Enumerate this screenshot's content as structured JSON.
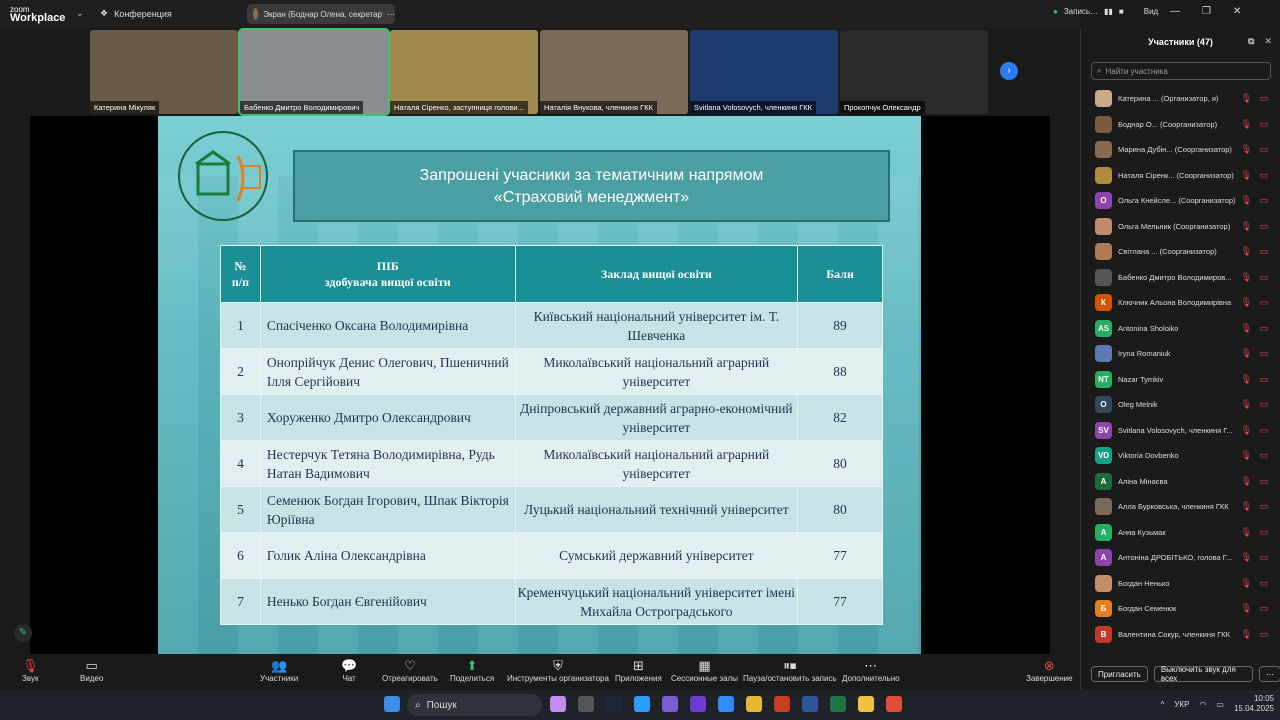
{
  "app": {
    "logo_top": "zoom",
    "logo_bottom": "Workplace",
    "meeting_label": "Конференция",
    "screen_share": "Экран (Боднар Олена, секретар",
    "recording": "Запись…",
    "view": "Вид"
  },
  "thumbnails": [
    {
      "name": "Катерина Мікуляк",
      "bg": "#6a5a48"
    },
    {
      "name": "Бабенко Дмитро Володимирович",
      "bg": "#8a8d92"
    },
    {
      "name": "Наталя Сіренко, заступниця голови...",
      "bg": "#a08a50"
    },
    {
      "name": "Наталія Внукова, членкиня ГКК",
      "bg": "#7a6a5a"
    },
    {
      "name": "Svitlana Volosovych, членкиня ГКК",
      "bg": "#1f3a6e"
    },
    {
      "name": "Прокопчук Олександр",
      "bg": "#2a2a2a"
    }
  ],
  "slide": {
    "title_line1": "Запрошені учасники за тематичним напрямом",
    "title_line2": "«Страховий менеджмент»",
    "headers": {
      "num": "№\nп/п",
      "pib": "ПІБ\nздобувача вищої освіти",
      "inst": "Заклад вищої  освіти",
      "score": "Бали"
    },
    "rows": [
      {
        "n": "1",
        "pib": "Спасіченко Оксана Володимирівна",
        "inst": "Київський національний університет ім. Т. Шевченка",
        "score": "89"
      },
      {
        "n": "2",
        "pib": "Онопрійчук Денис Олегович, Пшеничний Ілля Сергійович",
        "inst": "Миколаївський національний аграрний університет",
        "score": "88"
      },
      {
        "n": "3",
        "pib": "Хоруженко Дмитро Олександрович",
        "inst": "Дніпровський державний аграрно-економічний університет",
        "score": "82"
      },
      {
        "n": "4",
        "pib": "Нестерчук Тетяна Володимирівна, Рудь Натан Вадимович",
        "inst": "Миколаївський національний аграрний університет",
        "score": "80"
      },
      {
        "n": "5",
        "pib": "Семенюк Богдан Ігорович, Шпак Вікторія Юріївна",
        "inst": "Луцький національний технічний університет",
        "score": "80"
      },
      {
        "n": "6",
        "pib": "Голик Аліна Олександрівна",
        "inst": "Сумський державний університет",
        "score": "77"
      },
      {
        "n": "7",
        "pib": "Ненько Богдан Євгенійович",
        "inst": "Кременчуцький національний університет імені Михайла Остроградського",
        "score": "77"
      }
    ]
  },
  "participants": {
    "title": "Участники (47)",
    "search_placeholder": "Найти участника",
    "list": [
      {
        "name": "Катерина ... (Организатор, я)",
        "initials": "",
        "color": "#c9a98a"
      },
      {
        "name": "Боднар О... (Соорганизатор)",
        "initials": "",
        "color": "#7a5a40"
      },
      {
        "name": "Марина Дубін... (Соорганизатор)",
        "initials": "",
        "color": "#8a6a50"
      },
      {
        "name": "Наталя Сіренк... (Соорганизатор)",
        "initials": "",
        "color": "#b08a40"
      },
      {
        "name": "Ольга Кнейсле... (Соорганизатор)",
        "initials": "О",
        "color": "#8e44ad"
      },
      {
        "name": "Ольга Мельник (Соорганизатор)",
        "initials": "",
        "color": "#c08a70"
      },
      {
        "name": "Світлана ... (Соорганизатор)",
        "initials": "",
        "color": "#b07a50"
      },
      {
        "name": "Бабенко Дмитро Володимиров...",
        "initials": "",
        "color": "#555"
      },
      {
        "name": "Ключник Альона Володимирівна",
        "initials": "К",
        "color": "#d35400"
      },
      {
        "name": "Antonina Sholoiko",
        "initials": "AS",
        "color": "#27ae60"
      },
      {
        "name": "Iryna Romaniuk",
        "initials": "",
        "color": "#5a7ab0"
      },
      {
        "name": "Nazar Tymkiv",
        "initials": "NT",
        "color": "#27ae60"
      },
      {
        "name": "Oleg Melnik",
        "initials": "O",
        "color": "#34495e"
      },
      {
        "name": "Svitlana Volosovych, членкиня Г...",
        "initials": "SV",
        "color": "#8e44ad"
      },
      {
        "name": "Viktoria Dovbenko",
        "initials": "VD",
        "color": "#16a085"
      },
      {
        "name": "Аліна Мінаєва",
        "initials": "А",
        "color": "#1e6b3a"
      },
      {
        "name": "Алла Бурковська, членкиня ГКК",
        "initials": "",
        "color": "#7a6a5a"
      },
      {
        "name": "Анна Кузьмак",
        "initials": "А",
        "color": "#27ae60"
      },
      {
        "name": "Антоніна ДРОБІТЬКО, голова Г...",
        "initials": "А",
        "color": "#8e44ad"
      },
      {
        "name": "Богдан Ненько",
        "initials": "",
        "color": "#c0906a"
      },
      {
        "name": "Богдан Семенюк",
        "initials": "Б",
        "color": "#e67e22"
      },
      {
        "name": "Валентина Сокур, членкиня ГКК",
        "initials": "В",
        "color": "#c0392b"
      }
    ],
    "invite": "Пригласить",
    "mute_all": "Выключить звук для всех"
  },
  "controls": {
    "audio": "Звук",
    "video": "Видео",
    "participants": "Участники",
    "participants_count": "47",
    "chat": "Чат",
    "react": "Отреагировать",
    "share": "Поделиться",
    "host_tools": "Инструменты организатора",
    "apps": "Приложения",
    "breakout": "Сессионные залы",
    "pause_rec": "Пауза/остановить запись",
    "more": "Дополнительно",
    "end": "Завершение"
  },
  "taskbar": {
    "search": "Пошук",
    "lang": "УКР",
    "time": "10:05",
    "date": "15.04.2025"
  }
}
